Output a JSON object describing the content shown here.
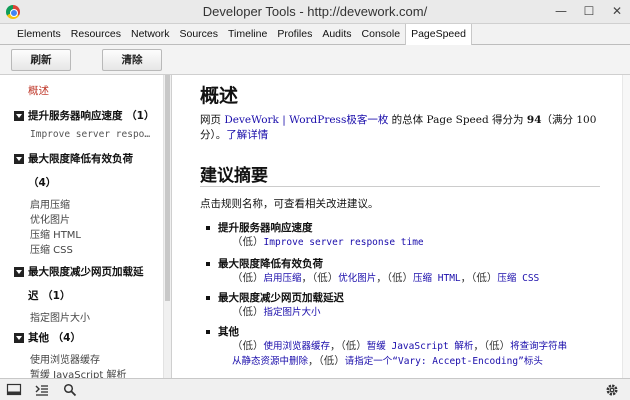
{
  "window": {
    "title": "Developer Tools - http://devework.com/",
    "minimize": "—",
    "maximize": "☐",
    "close": "✕"
  },
  "tabs": [
    {
      "label": "Elements"
    },
    {
      "label": "Resources"
    },
    {
      "label": "Network"
    },
    {
      "label": "Sources"
    },
    {
      "label": "Timeline"
    },
    {
      "label": "Profiles"
    },
    {
      "label": "Audits"
    },
    {
      "label": "Console"
    },
    {
      "label": "PageSpeed"
    }
  ],
  "toolbar": {
    "refresh_label": "刷新",
    "clear_label": "清除"
  },
  "sidebar": {
    "overview": "概述",
    "groups": [
      {
        "label": "提升服务器响应速度 （1）",
        "items": [
          "Improve server respo…"
        ]
      },
      {
        "label": "最大限度降低有效负荷",
        "count": "（4）",
        "items": [
          "启用压缩",
          "优化图片",
          "压缩 HTML",
          "压缩 CSS"
        ]
      },
      {
        "label": "最大限度减少网页加载延",
        "count": "迟 （1）",
        "items": [
          "指定图片大小"
        ]
      },
      {
        "label": "其他 （4）",
        "items": [
          "使用浏览器缓存",
          "暂缓 JavaScript 解析"
        ]
      }
    ]
  },
  "content": {
    "title": "概述",
    "summary_prefix": "网页 ",
    "summary_site": "DeveWork | WordPress极客一枚",
    "summary_mid": " 的总体 Page Speed 得分为 ",
    "summary_score": "94",
    "summary_suffix": "（满分 100 分）。",
    "summary_link": "了解详情",
    "suggestions_title": "建议摘要",
    "intro": "点击规则名称，可查看相关改进建议。",
    "rules": [
      {
        "title": "提升服务器响应速度",
        "desc": [
          {
            "p": "（低）",
            "link": "Improve server response time"
          }
        ]
      },
      {
        "title": "最大限度降低有效负荷",
        "desc": [
          {
            "p": "（低）",
            "link": "启用压缩"
          },
          {
            "p": "，（低）",
            "link": "优化图片"
          },
          {
            "p": "，（低）",
            "link": "压缩 HTML"
          },
          {
            "p": "，（低）",
            "link": "压缩 CSS"
          }
        ]
      },
      {
        "title": "最大限度减少网页加载延迟",
        "desc": [
          {
            "p": "（低）",
            "link": "指定图片大小"
          }
        ]
      },
      {
        "title": "其他",
        "line1": [
          {
            "p": "（低）",
            "link": "使用浏览器缓存"
          },
          {
            "p": "，（低）",
            "link": "暂缓 JavaScript 解析"
          },
          {
            "p": "，（低）",
            "link": "将查询字符串"
          }
        ],
        "line2": [
          {
            "p": "",
            "link": "从静态资源中删除"
          },
          {
            "p": "，（低）",
            "link": "请指定一个“Vary: Accept-Encoding”标头"
          }
        ]
      }
    ]
  },
  "bottom": {
    "dock_icon": "dock-icon",
    "console_icon": "console-icon",
    "search_icon": "search-icon",
    "settings_icon": "gear-icon"
  }
}
